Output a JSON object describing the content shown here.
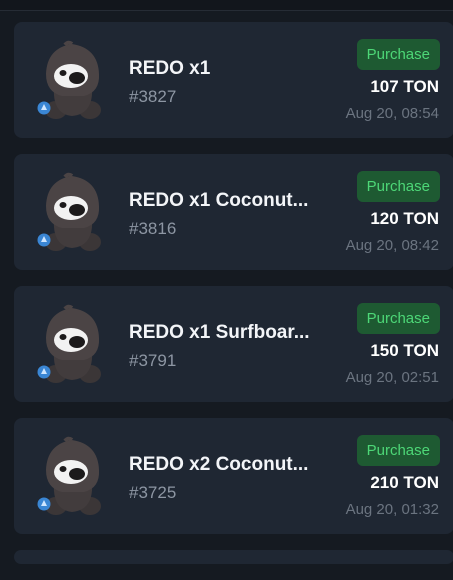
{
  "listings": [
    {
      "title": "REDO x1",
      "number": "#3827",
      "purchase_label": "Purchase",
      "price": "107 TON",
      "date": "Aug 20, 08:54"
    },
    {
      "title": "REDO x1 Coconut...",
      "number": "#3816",
      "purchase_label": "Purchase",
      "price": "120 TON",
      "date": "Aug 20, 08:42"
    },
    {
      "title": "REDO x1 Surfboar...",
      "number": "#3791",
      "purchase_label": "Purchase",
      "price": "150 TON",
      "date": "Aug 20, 02:51"
    },
    {
      "title": "REDO x2 Coconut...",
      "number": "#3725",
      "purchase_label": "Purchase",
      "price": "210 TON",
      "date": "Aug 20, 01:32"
    }
  ]
}
